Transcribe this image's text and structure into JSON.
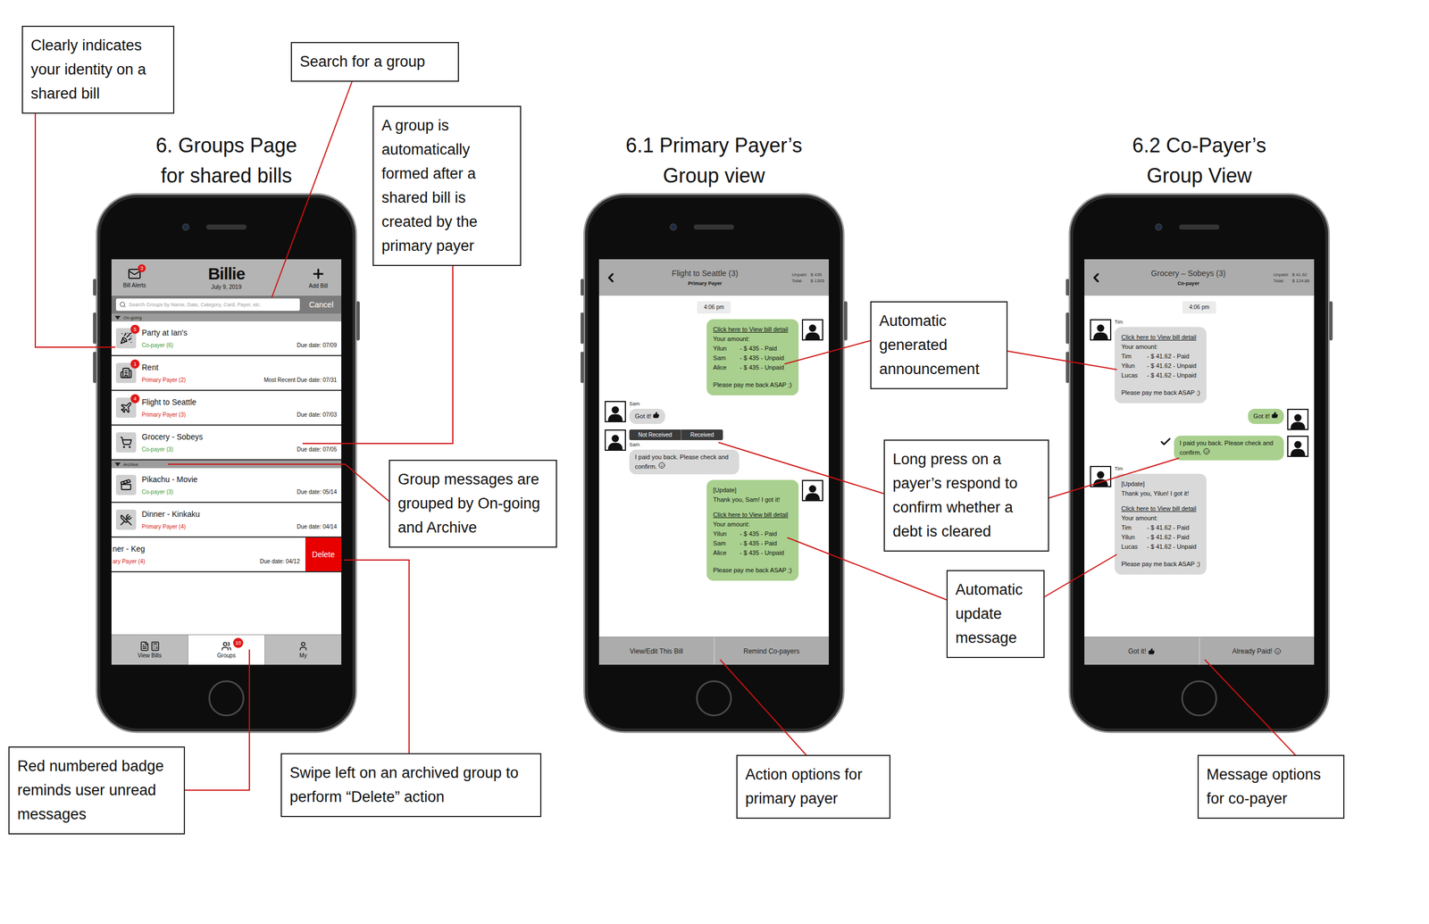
{
  "annotations": [
    "Clearly indicates your identity on a shared bill",
    "Search for a group",
    "A group is automatically formed after a shared bill is created by the primary payer",
    "Group messages are grouped by On-going and Archive",
    "Red numbered badge reminds user unread messages",
    "Swipe left on an archived group to perform “Delete” action",
    "Automatic generated announcement",
    "Long press on a payer’s respond to confirm whether a debt is cleared",
    "Automatic update message",
    "Action options for primary payer",
    "Message options for co-payer"
  ],
  "groups_page": {
    "title_lines": [
      "6. Groups Page",
      "for shared bills"
    ],
    "alerts": {
      "label": "Bill Alerts",
      "badge": "3"
    },
    "app_name": "Billie",
    "date": "July 9, 2019",
    "add": {
      "label": "Add Bill"
    },
    "search": {
      "placeholder": "Search Groups by Name, Date, Category, Card, Payer, etc.",
      "cancel": "Cancel"
    },
    "sections": [
      {
        "label": "On-going",
        "rows": [
          {
            "name": "Party at Ian's",
            "role": "Co-payer (6)",
            "color": "#3d9b35",
            "due": "Due date: 07/09",
            "badge": "5",
            "swiped": false
          },
          {
            "name": "Rent",
            "role": "Primary Payer (2)",
            "color": "#d42020",
            "due": "Most Recent Due date: 07/31",
            "badge": "1",
            "swiped": false
          },
          {
            "name": "Flight to Seattle",
            "role": "Primary Payer (3)",
            "color": "#d42020",
            "due": "Due date: 07/03",
            "badge": "4",
            "swiped": false
          },
          {
            "name": "Grocery - Sobeys",
            "role": "Co-payer (3)",
            "color": "#3d9b35",
            "due": "Due date: 07/05",
            "swiped": false
          }
        ]
      },
      {
        "label": "Archive",
        "rows": [
          {
            "name": "Pikachu - Movie",
            "role": "Co-payer (3)",
            "color": "#3d9b35",
            "due": "Due date: 05/14",
            "swiped": false
          },
          {
            "name": "Dinner - Kinkaku",
            "role": "Primary Payer (4)",
            "color": "#d42020",
            "due": "Due date: 04/14",
            "swiped": false
          },
          {
            "name": "ner - Keg",
            "role": "ary Payer (4)",
            "color": "#d42020",
            "due": "Due date: 04/12",
            "swiped": true,
            "action": "Delete"
          }
        ]
      }
    ],
    "tabs": [
      {
        "label": "View Bills",
        "selected": false
      },
      {
        "label": "Groups",
        "selected": true,
        "badge": "10"
      },
      {
        "label": "My",
        "selected": false
      }
    ]
  },
  "chats": [
    {
      "title_lines": [
        "6.1 Primary Payer’s",
        "Group view"
      ],
      "title": "Flight to Seattle (3)",
      "role": "Primary Payer",
      "stats": [
        {
          "label": "Unpaid:",
          "value": "$ 435"
        },
        {
          "label": "Total:",
          "value": "$ 1305"
        }
      ],
      "time": "4:06 pm",
      "messages": [
        {
          "kind": "bill",
          "mine": true,
          "link": "Click here to View bill detail",
          "amount_label": "Your amount:",
          "lines": [
            [
              "Yilun",
              "- $ 435 - Paid"
            ],
            [
              "Sam",
              "- $ 435 - Unpaid"
            ],
            [
              "Alice",
              "- $ 435 - Unpaid"
            ]
          ],
          "footer": "Please pay me back ASAP ;)"
        },
        {
          "kind": "like",
          "mine": false,
          "sender": "Sam",
          "text": "Got it!"
        },
        {
          "kind": "smile",
          "mine": false,
          "sender": "Sam",
          "text": "I paid you back. Please check and confirm.",
          "confirmed": false,
          "menu": [
            "Not Received",
            "Received"
          ]
        },
        {
          "kind": "bill",
          "mine": true,
          "update": "[Update]",
          "thanks": "Thank you, Sam! I got it!",
          "link": "Click here to View bill detail",
          "amount_label": "Your amount:",
          "lines": [
            [
              "Yilun",
              "- $ 435 - Paid"
            ],
            [
              "Sam",
              "- $ 435 - Paid"
            ],
            [
              "Alice",
              "- $ 435 - Unpaid"
            ]
          ],
          "footer": "Please pay me back ASAP ;)"
        }
      ],
      "actions": [
        {
          "label": "View/Edit This Bill",
          "kind": "text"
        },
        {
          "label": "Remind Co-payers",
          "kind": "text"
        }
      ]
    },
    {
      "title_lines": [
        "6.2 Co-Payer’s",
        "Group View"
      ],
      "title": "Grocery – Sobeys (3)",
      "role": "Co-payer",
      "stats": [
        {
          "label": "Unpaid:",
          "value": "$ 41.62"
        },
        {
          "label": "Total:",
          "value": "$ 124.86"
        }
      ],
      "time": "4:06 pm",
      "messages": [
        {
          "kind": "bill",
          "mine": false,
          "sender": "Tim",
          "link": "Click here to View bill detail",
          "amount_label": "Your amount:",
          "lines": [
            [
              "Tim",
              "- $ 41.62 - Paid"
            ],
            [
              "Yilun",
              "- $ 41.62 - Unpaid"
            ],
            [
              "Lucas",
              "- $ 41.62 - Unpaid"
            ]
          ],
          "footer": "Please pay me back ASAP ;)"
        },
        {
          "kind": "like",
          "mine": true,
          "text": "Got it!"
        },
        {
          "kind": "smile",
          "mine": true,
          "text": "I paid you back. Please check and confirm.",
          "confirmed": true
        },
        {
          "kind": "bill",
          "mine": false,
          "sender": "Tim",
          "update": "[Update]",
          "thanks": "Thank you, Yilun! I got it!",
          "link": "Click here to View bill detail",
          "amount_label": "Your amount:",
          "lines": [
            [
              "Tim",
              "- $ 41.62 - Paid"
            ],
            [
              "Yilun",
              "- $ 41.62 - Paid"
            ],
            [
              "Lucas",
              "- $ 41.62 - Unpaid"
            ]
          ],
          "footer": "Please pay me back ASAP ;)"
        }
      ],
      "actions": [
        {
          "label": "Got it!",
          "kind": "like"
        },
        {
          "label": "Already Paid!",
          "kind": "smile"
        }
      ]
    }
  ]
}
